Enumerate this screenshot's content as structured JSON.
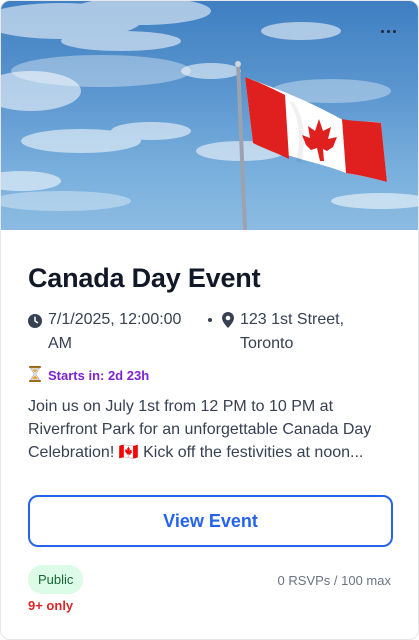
{
  "event": {
    "title": "Canada Day Event",
    "datetime": "7/1/2025, 12:00:00 AM",
    "location": "123 1st Street, Toronto",
    "countdown": "Starts in: 2d 23h",
    "description": "Join us on July 1st from 12 PM to 10 PM at Riverfront Park for an unforgettable Canada Day Celebration! 🇨🇦 Kick off the festivities at noon...",
    "view_button_label": "View Event",
    "visibility_badge": "Public",
    "age_restriction": "9+ only",
    "rsvp_text": "0 RSVPs / 100 max"
  },
  "icons": {
    "more": "more-horizontal-icon",
    "clock": "clock-icon",
    "location": "map-pin-icon",
    "hourglass": "hourglass-icon"
  },
  "colors": {
    "accent": "#2563eb",
    "countdown": "#7e22ce",
    "badge_bg": "#dcfce7",
    "badge_text": "#166534",
    "age_text": "#dc2626",
    "flag_red": "#e0201e"
  }
}
